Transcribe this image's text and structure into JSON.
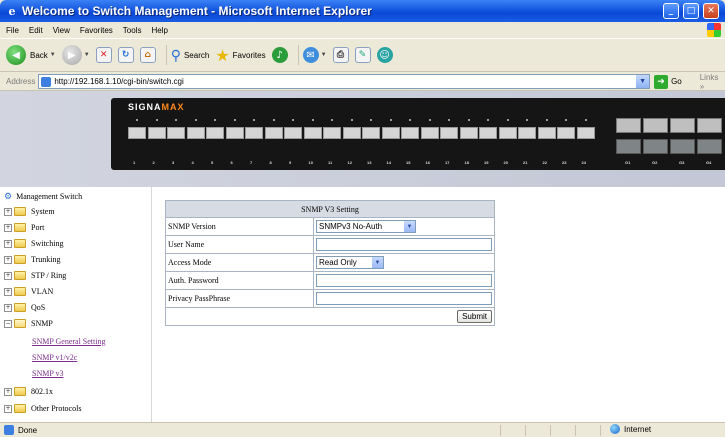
{
  "window": {
    "title": "Welcome to Switch Management - Microsoft Internet Explorer",
    "minimize": "_",
    "maximize": "□",
    "close": "✕"
  },
  "menu": [
    "File",
    "Edit",
    "View",
    "Favorites",
    "Tools",
    "Help"
  ],
  "toolbar": {
    "back": "Back",
    "search": "Search",
    "favorites": "Favorites"
  },
  "address": {
    "label": "Address",
    "url": "http://192.168.1.10/cgi-bin/switch.cgi",
    "go": "Go",
    "links": "Links"
  },
  "banner": {
    "brand_main": "SIGNA",
    "brand_accent": "MAX",
    "port_numbers": [
      "1",
      "2",
      "3",
      "4",
      "5",
      "6",
      "7",
      "8",
      "9",
      "10",
      "11",
      "12",
      "13",
      "14",
      "15",
      "16",
      "17",
      "18",
      "19",
      "20",
      "21",
      "22",
      "23",
      "24"
    ],
    "uplink_numbers": [
      "G1",
      "G2",
      "G3",
      "G4"
    ]
  },
  "sidebar": {
    "root": "Management Switch",
    "items": [
      "System",
      "Port",
      "Switching",
      "Trunking",
      "STP / Ring",
      "VLAN",
      "QoS",
      "SNMP"
    ],
    "snmp_children": [
      "SNMP General Setting",
      "SNMP v1/v2c",
      "SNMP v3"
    ],
    "after": [
      "802.1x",
      "Other Protocols"
    ]
  },
  "form": {
    "title": "SNMP V3 Setting",
    "rows": {
      "version_label": "SNMP Version",
      "version_value": "SNMPv3 No-Auth",
      "user_label": "User Name",
      "access_label": "Access Mode",
      "access_value": "Read Only",
      "auth_label": "Auth. Password",
      "privacy_label": "Privacy PassPhrase"
    },
    "submit": "Submit"
  },
  "status": {
    "text": "Done",
    "zone": "Internet"
  }
}
